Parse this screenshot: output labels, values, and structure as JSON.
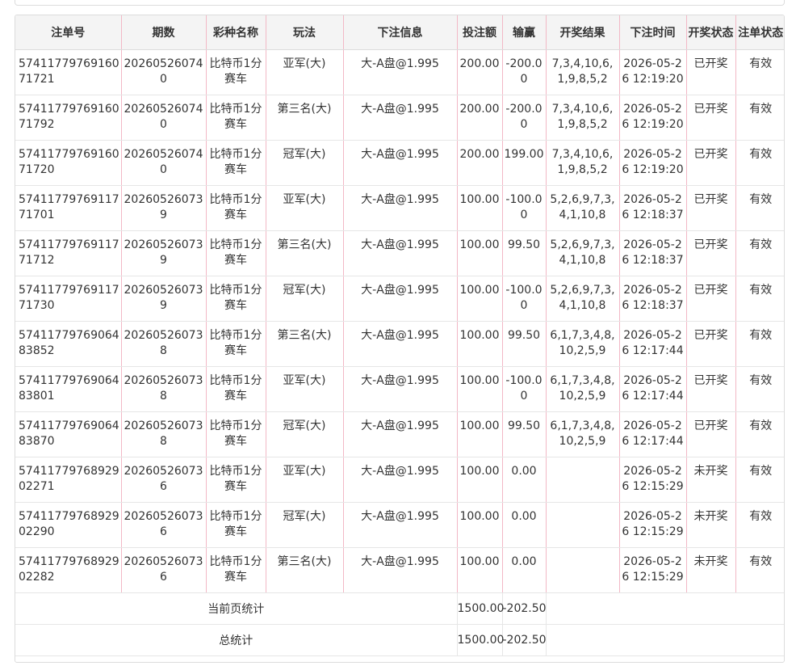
{
  "headers": [
    "注单号",
    "期数",
    "彩种名称",
    "玩法",
    "下注信息",
    "投注额",
    "输赢",
    "开奖结果",
    "下注时间",
    "开奖状态",
    "注单状态"
  ],
  "rows": [
    {
      "id": "5741177976916071721",
      "period": "202605260740",
      "lottery": "比特币1分赛车",
      "play": "亚军(大)",
      "info": "大-A盘@1.995",
      "amount": "200.00",
      "winloss": "-200.00",
      "result": "7,3,4,10,6,1,9,8,5,2",
      "time": "2026-05-26 12:19:20",
      "draw_status": "已开奖",
      "bet_status": "有效"
    },
    {
      "id": "5741177976916071792",
      "period": "202605260740",
      "lottery": "比特币1分赛车",
      "play": "第三名(大)",
      "info": "大-A盘@1.995",
      "amount": "200.00",
      "winloss": "-200.00",
      "result": "7,3,4,10,6,1,9,8,5,2",
      "time": "2026-05-26 12:19:20",
      "draw_status": "已开奖",
      "bet_status": "有效"
    },
    {
      "id": "5741177976916071720",
      "period": "202605260740",
      "lottery": "比特币1分赛车",
      "play": "冠军(大)",
      "info": "大-A盘@1.995",
      "amount": "200.00",
      "winloss": "199.00",
      "result": "7,3,4,10,6,1,9,8,5,2",
      "time": "2026-05-26 12:19:20",
      "draw_status": "已开奖",
      "bet_status": "有效"
    },
    {
      "id": "5741177976911771701",
      "period": "202605260739",
      "lottery": "比特币1分赛车",
      "play": "亚军(大)",
      "info": "大-A盘@1.995",
      "amount": "100.00",
      "winloss": "-100.00",
      "result": "5,2,6,9,7,3,4,1,10,8",
      "time": "2026-05-26 12:18:37",
      "draw_status": "已开奖",
      "bet_status": "有效"
    },
    {
      "id": "5741177976911771712",
      "period": "202605260739",
      "lottery": "比特币1分赛车",
      "play": "第三名(大)",
      "info": "大-A盘@1.995",
      "amount": "100.00",
      "winloss": "99.50",
      "result": "5,2,6,9,7,3,4,1,10,8",
      "time": "2026-05-26 12:18:37",
      "draw_status": "已开奖",
      "bet_status": "有效"
    },
    {
      "id": "5741177976911771730",
      "period": "202605260739",
      "lottery": "比特币1分赛车",
      "play": "冠军(大)",
      "info": "大-A盘@1.995",
      "amount": "100.00",
      "winloss": "-100.00",
      "result": "5,2,6,9,7,3,4,1,10,8",
      "time": "2026-05-26 12:18:37",
      "draw_status": "已开奖",
      "bet_status": "有效"
    },
    {
      "id": "5741177976906483852",
      "period": "202605260738",
      "lottery": "比特币1分赛车",
      "play": "第三名(大)",
      "info": "大-A盘@1.995",
      "amount": "100.00",
      "winloss": "99.50",
      "result": "6,1,7,3,4,8,10,2,5,9",
      "time": "2026-05-26 12:17:44",
      "draw_status": "已开奖",
      "bet_status": "有效"
    },
    {
      "id": "5741177976906483801",
      "period": "202605260738",
      "lottery": "比特币1分赛车",
      "play": "亚军(大)",
      "info": "大-A盘@1.995",
      "amount": "100.00",
      "winloss": "-100.00",
      "result": "6,1,7,3,4,8,10,2,5,9",
      "time": "2026-05-26 12:17:44",
      "draw_status": "已开奖",
      "bet_status": "有效"
    },
    {
      "id": "5741177976906483870",
      "period": "202605260738",
      "lottery": "比特币1分赛车",
      "play": "冠军(大)",
      "info": "大-A盘@1.995",
      "amount": "100.00",
      "winloss": "99.50",
      "result": "6,1,7,3,4,8,10,2,5,9",
      "time": "2026-05-26 12:17:44",
      "draw_status": "已开奖",
      "bet_status": "有效"
    },
    {
      "id": "5741177976892902271",
      "period": "202605260736",
      "lottery": "比特币1分赛车",
      "play": "亚军(大)",
      "info": "大-A盘@1.995",
      "amount": "100.00",
      "winloss": "0.00",
      "result": "",
      "time": "2026-05-26 12:15:29",
      "draw_status": "未开奖",
      "bet_status": "有效"
    },
    {
      "id": "5741177976892902290",
      "period": "202605260736",
      "lottery": "比特币1分赛车",
      "play": "冠军(大)",
      "info": "大-A盘@1.995",
      "amount": "100.00",
      "winloss": "0.00",
      "result": "",
      "time": "2026-05-26 12:15:29",
      "draw_status": "未开奖",
      "bet_status": "有效"
    },
    {
      "id": "5741177976892902282",
      "period": "202605260736",
      "lottery": "比特币1分赛车",
      "play": "第三名(大)",
      "info": "大-A盘@1.995",
      "amount": "100.00",
      "winloss": "0.00",
      "result": "",
      "time": "2026-05-26 12:15:29",
      "draw_status": "未开奖",
      "bet_status": "有效"
    }
  ],
  "summary": {
    "page_label": "当前页统计",
    "page_amount": "1500.00",
    "page_winloss": "-202.50",
    "total_label": "总统计",
    "total_amount": "1500.00",
    "total_winloss": "-202.50"
  }
}
